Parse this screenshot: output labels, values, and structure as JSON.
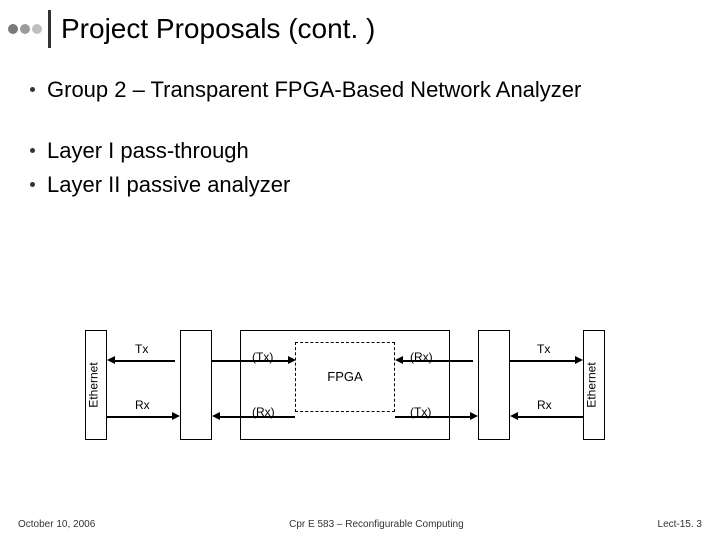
{
  "header": {
    "title": "Project Proposals (cont. )",
    "dot_colors": [
      "#7a7a7a",
      "#9c9c9c",
      "#bfbfbf"
    ]
  },
  "bullets": [
    "Group 2 – Transparent FPGA-Based Network Analyzer",
    "Layer I pass-through",
    "Layer II passive analyzer"
  ],
  "diagram": {
    "left_interface": "Ethernet",
    "right_interface": "Ethernet",
    "fpga_label": "FPGA",
    "signals": {
      "tx": "Tx",
      "rx": "Rx",
      "tx_paren": "(Tx)",
      "rx_paren": "(Rx)"
    }
  },
  "footer": {
    "left": "October 10, 2006",
    "center": "Cpr E 583 – Reconfigurable Computing",
    "right": "Lect-15. 3"
  }
}
